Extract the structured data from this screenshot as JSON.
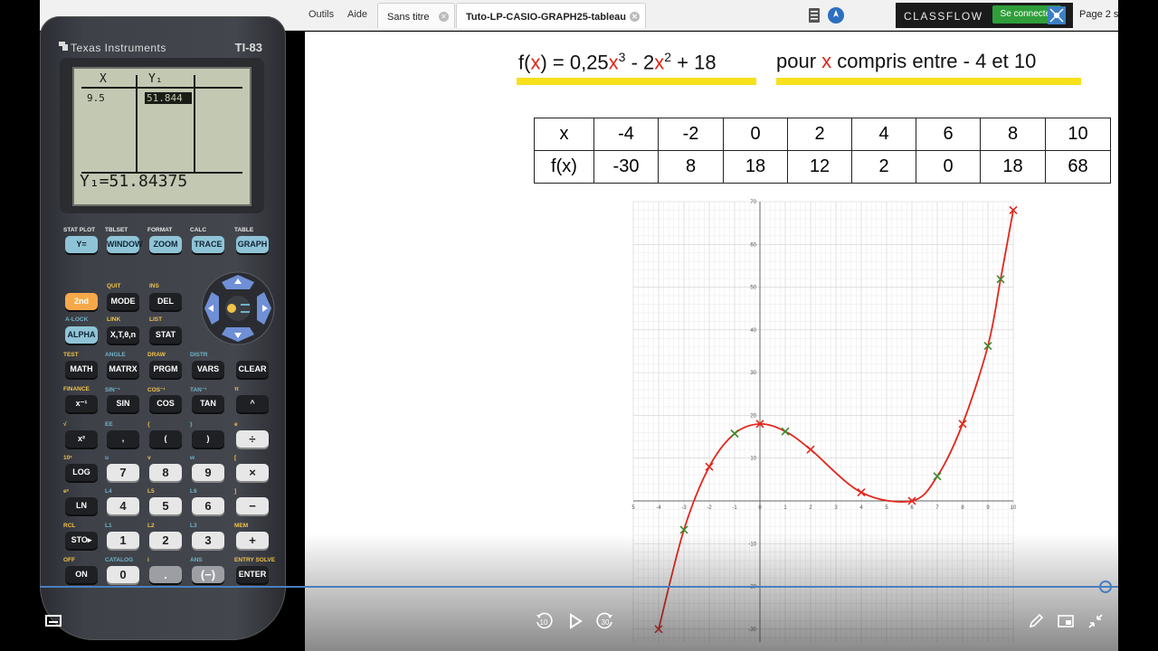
{
  "toolbar": {
    "menu": [
      "Outils",
      "Aide"
    ],
    "tabs": [
      {
        "label": "Sans titre",
        "active": false
      },
      {
        "label": "Tuto-LP-CASIO-GRAPH25-tableau",
        "active": true
      }
    ],
    "classflow_logo": "CLASSFLOW",
    "connect_label": "Se connecter",
    "page_label": "Page 2 s"
  },
  "calculator": {
    "brand": "Texas Instruments",
    "model": "TI-83",
    "screen": {
      "col_x": "X",
      "col_y": "Y₁",
      "row_x": "9.5",
      "row_y": "51.844",
      "formula": "Y₁=51.84375"
    },
    "keys": {
      "row1": [
        "Y=",
        "WINDOW",
        "ZOOM",
        "TRACE",
        "GRAPH"
      ],
      "row1_labels": [
        "STAT PLOT",
        "TBLSET",
        "FORMAT",
        "CALC",
        "TABLE"
      ],
      "row2": [
        "2nd",
        "MODE",
        "DEL"
      ],
      "row2_labels": [
        "QUIT",
        "INS"
      ],
      "row3": [
        "ALPHA",
        "X,T,θ,n",
        "STAT"
      ],
      "row3_labels": [
        "A-LOCK",
        "LINK",
        "LIST"
      ],
      "row4": [
        "MATH",
        "MATRX",
        "PRGM",
        "VARS",
        "CLEAR"
      ],
      "row4_labels": [
        "TEST",
        "ANGLE",
        "DRAW",
        "DISTR"
      ],
      "row5": [
        "x⁻¹",
        "SIN",
        "COS",
        "TAN",
        "^"
      ],
      "row5_labels": [
        "FINANCE",
        "SIN⁻¹",
        "COS⁻¹",
        "TAN⁻¹",
        "π"
      ],
      "row6": [
        "x²",
        ",",
        "(",
        ")",
        "÷"
      ],
      "row6_labels": [
        "√",
        "EE",
        "{",
        "}",
        "e"
      ],
      "row7": [
        "LOG",
        "7",
        "8",
        "9",
        "×"
      ],
      "row7_labels": [
        "10ˣ",
        "u",
        "v",
        "w",
        "["
      ],
      "row8": [
        "LN",
        "4",
        "5",
        "6",
        "−"
      ],
      "row8_labels": [
        "eˣ",
        "L4",
        "L5",
        "L6",
        "]"
      ],
      "row9": [
        "STO▸",
        "1",
        "2",
        "3",
        "+"
      ],
      "row9_labels": [
        "RCL",
        "L1",
        "L2",
        "L3",
        "MEM"
      ],
      "row10": [
        "ON",
        "0",
        ".",
        "(−)",
        "ENTER"
      ],
      "row10_labels": [
        "OFF",
        "CATALOG",
        "i",
        "ANS",
        "ENTRY SOLVE"
      ]
    }
  },
  "board": {
    "formula_parts": [
      "f(",
      "x",
      ") = 0,25",
      "x",
      "3",
      " - 2",
      "x",
      "2",
      " + 18"
    ],
    "range_parts": [
      "pour ",
      "x",
      " compris entre - 4 et 10"
    ],
    "table": {
      "row_x_label": "x",
      "row_f_label": "f(x)",
      "x": [
        "-4",
        "-2",
        "0",
        "2",
        "4",
        "6",
        "8",
        "10"
      ],
      "f": [
        "-30",
        "8",
        "18",
        "12",
        "2",
        "0",
        "18",
        "68"
      ]
    }
  },
  "chart_data": {
    "type": "line",
    "title": "",
    "xlabel": "",
    "ylabel": "",
    "xlim": [
      -5,
      10
    ],
    "ylim": [
      -33,
      70
    ],
    "xticks": [
      "5",
      "-4",
      "-3",
      "-2",
      "-1",
      "0",
      "1",
      "2",
      "3",
      "4",
      "5",
      "6",
      "7",
      "8",
      "9",
      "10"
    ],
    "yticks": [
      "70",
      "60",
      "50",
      "40",
      "30",
      "20",
      "10",
      "-10",
      "-20",
      "-30"
    ],
    "grid": true,
    "curve_color": "#e3261c",
    "series": [
      {
        "marker": "x",
        "color": "#e3261c",
        "x": [
          -4,
          -2,
          0,
          2,
          4,
          6,
          8,
          10
        ],
        "y": [
          -30,
          8,
          18,
          12,
          2,
          0,
          18,
          68
        ]
      },
      {
        "marker": "x",
        "color": "#3a8a2e",
        "x": [
          -3,
          -1,
          1,
          7,
          9,
          9.5
        ],
        "y": [
          -6.75,
          15.75,
          16.25,
          5.75,
          36.25,
          51.84
        ]
      }
    ]
  },
  "video": {
    "progress": 0.99,
    "rewind_label": "10",
    "forward_label": "30"
  }
}
